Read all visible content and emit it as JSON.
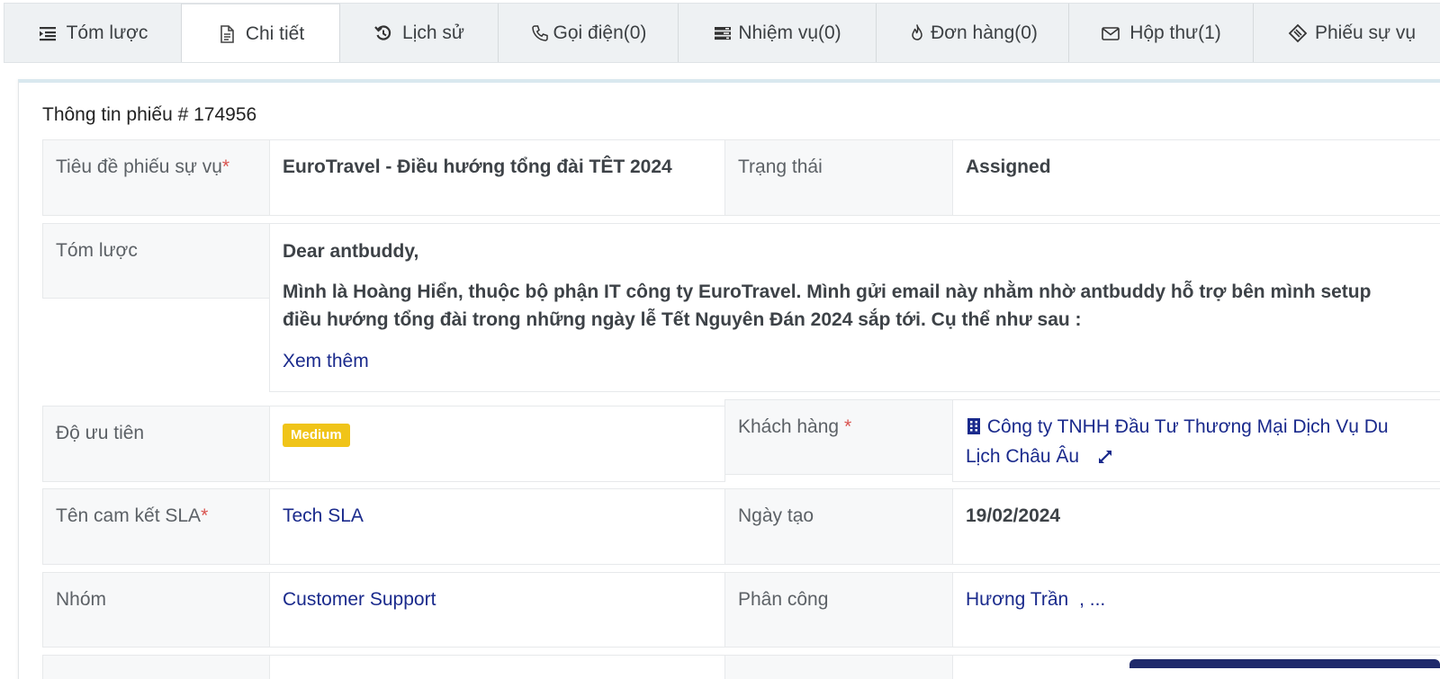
{
  "tabs": [
    {
      "label": "Tóm lược",
      "icon": "list-indent-icon"
    },
    {
      "label": "Chi tiết",
      "icon": "document-icon",
      "active": true
    },
    {
      "label": "Lịch sử",
      "icon": "history-icon"
    },
    {
      "label": "Gọi điện(0)",
      "icon": "phone-icon"
    },
    {
      "label": "Nhiệm vụ(0)",
      "icon": "tasks-icon"
    },
    {
      "label": "Đơn hàng(0)",
      "icon": "fire-icon"
    },
    {
      "label": "Hộp thư(1)",
      "icon": "envelope-icon"
    },
    {
      "label": "Phiếu sự vụ",
      "icon": "ticket-icon"
    }
  ],
  "ticket": {
    "title": "Thông tin phiếu # 174956",
    "subject_label": "Tiêu đề phiếu sự vụ",
    "subject_value": "EuroTravel - Điều hướng tổng đài TÊT 2024",
    "status_label": "Trạng thái",
    "status_value": "Assigned",
    "summary_label": "Tóm lược",
    "summary_greeting": "Dear antbuddy,",
    "summary_body": "Mình là Hoàng Hiển, thuộc bộ phận IT công ty EuroTravel. Mình gửi email này nhằm nhờ antbuddy hỗ trợ bên mình setup điều hướng tổng đài trong những ngày lễ Tết Nguyên Đán 2024 sắp tới. Cụ thể như sau :",
    "summary_more": "Xem thêm",
    "priority_label": "Độ ưu tiên",
    "priority_value": "Medium",
    "priority_color": "#f0c419",
    "customer_label": "Khách hàng",
    "customer_value": "Công ty TNHH Đầu Tư Thương Mại Dịch Vụ Du Lịch Châu Âu",
    "sla_label": "Tên cam kết SLA",
    "sla_value": "Tech SLA",
    "created_label": "Ngày tạo",
    "created_value": "19/02/2024",
    "group_label": "Nhóm",
    "group_value": "Customer Support",
    "assign_label": "Phân công",
    "assign_value": "Hương Trần",
    "assign_more": ", ...",
    "required_mark": "*"
  },
  "colors": {
    "link": "#1a2a8c",
    "required": "#d9534f",
    "accent_bar": "#1f2a6b"
  }
}
